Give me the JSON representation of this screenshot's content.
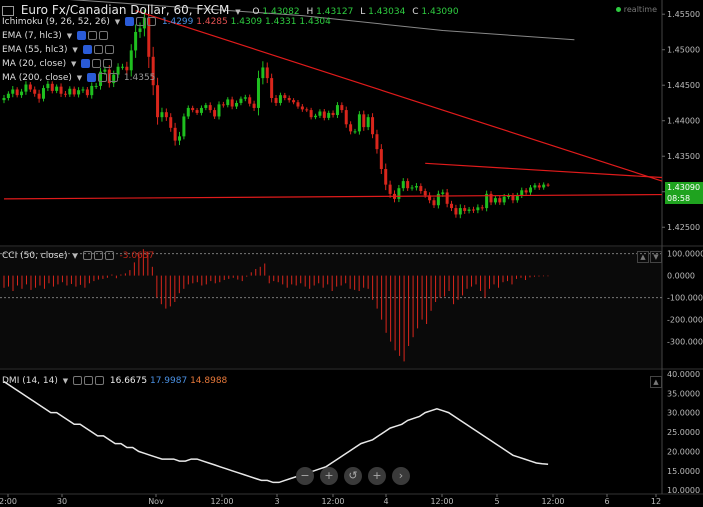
{
  "header": {
    "symbol": "Euro Fx/Canadian Dollar, 60, FXCM",
    "o_label": "O",
    "o": "1.43082",
    "h_label": "H",
    "h": "1.43127",
    "l_label": "L",
    "l": "1.43034",
    "c_label": "C",
    "c": "1.43090",
    "status": "realtime"
  },
  "indicators": [
    {
      "label": "Ichimoku (9, 26, 52, 26)",
      "values": [
        "1.4299",
        "1.4285",
        "1.4309",
        "1.4331",
        "1.4304"
      ]
    },
    {
      "label": "EMA (7, hlc3)",
      "values": []
    },
    {
      "label": "EMA (55, hlc3)",
      "values": []
    },
    {
      "label": "MA (20, close)",
      "values": []
    },
    {
      "label": "MA (200, close)",
      "values": [
        "1.4355"
      ]
    }
  ],
  "price_badge": {
    "price": "1.43090",
    "countdown": "08:58"
  },
  "cci": {
    "label": "CCI (50, close)",
    "value": "-3.0637"
  },
  "dmi": {
    "label": "DMI (14, 14)",
    "adx": "16.6675",
    "di_plus": "17.9987",
    "di_minus": "14.8988"
  },
  "colors": {
    "up": "#1fbf1f",
    "down": "#d9261c",
    "trend": "#e01b1b",
    "ma200": "#888888",
    "dmi": "#e8e8e8",
    "blue": "#4a90e2",
    "orange": "#e6783a",
    "green": "#2ecc40"
  },
  "icons": [
    "zoom-out-icon",
    "zoom-in-icon",
    "reset-icon",
    "add-icon",
    "pan-right-icon"
  ],
  "chart_data": [
    {
      "type": "candlestick",
      "title": "Euro Fx/Canadian Dollar, 60, FXCM",
      "ylim": [
        1.4225,
        1.457
      ],
      "yticks": [
        "1.45500",
        "1.45000",
        "1.44500",
        "1.44000",
        "1.43500",
        "1.43000",
        "1.42500"
      ],
      "x_ticks": [
        "2:00",
        "30",
        "Nov",
        "12:00",
        "3",
        "12:00",
        "4",
        "12:00",
        "5",
        "12:00",
        "6",
        "12"
      ],
      "close": [
        1.4432,
        1.4438,
        1.4444,
        1.4436,
        1.4441,
        1.4451,
        1.4444,
        1.4438,
        1.4431,
        1.4446,
        1.4452,
        1.4442,
        1.4448,
        1.4438,
        1.4437,
        1.4445,
        1.4437,
        1.4443,
        1.4444,
        1.4436,
        1.4449,
        1.4449,
        1.4469,
        1.4472,
        1.4453,
        1.4465,
        1.4476,
        1.4476,
        1.4471,
        1.4499,
        1.4525,
        1.453,
        1.4545,
        1.449,
        1.445,
        1.4405,
        1.4412,
        1.4405,
        1.439,
        1.4372,
        1.4378,
        1.4406,
        1.4418,
        1.4415,
        1.4411,
        1.4418,
        1.4422,
        1.4415,
        1.4406,
        1.4423,
        1.4422,
        1.443,
        1.442,
        1.4425,
        1.4431,
        1.4433,
        1.4424,
        1.4418,
        1.446,
        1.4475,
        1.446,
        1.4432,
        1.4425,
        1.4436,
        1.4432,
        1.4429,
        1.4426,
        1.442,
        1.4416,
        1.4415,
        1.4405,
        1.4407,
        1.4413,
        1.4404,
        1.4411,
        1.4408,
        1.4422,
        1.4415,
        1.4395,
        1.4385,
        1.4385,
        1.4409,
        1.4391,
        1.4405,
        1.4381,
        1.436,
        1.4332,
        1.431,
        1.4297,
        1.429,
        1.4305,
        1.4315,
        1.4305,
        1.4306,
        1.4308,
        1.4301,
        1.4295,
        1.4288,
        1.4281,
        1.4297,
        1.4299,
        1.4283,
        1.4277,
        1.4268,
        1.4277,
        1.4273,
        1.4275,
        1.4274,
        1.4278,
        1.4277,
        1.4297,
        1.4285,
        1.4291,
        1.4285,
        1.4293,
        1.4294,
        1.4288,
        1.4295,
        1.4302,
        1.4299,
        1.4306,
        1.4309,
        1.4306,
        1.431,
        1.4309
      ],
      "bar_range": [
        0.0012,
        0.001,
        0.0014,
        0.0009,
        0.0011,
        0.0013,
        0.001,
        0.0012,
        0.0016,
        0.0011,
        0.0012,
        0.001,
        0.0009,
        0.0013,
        0.0011,
        0.001,
        0.0009,
        0.0012,
        0.0011,
        0.001,
        0.0014,
        0.0012,
        0.0015,
        0.0013,
        0.0018,
        0.0016,
        0.0014,
        0.0012,
        0.002,
        0.0025,
        0.003,
        0.0024,
        0.0032,
        0.0045,
        0.004,
        0.003,
        0.0018,
        0.0015,
        0.0016,
        0.002,
        0.0018,
        0.0012,
        0.001,
        0.0009,
        0.0008,
        0.001,
        0.0009,
        0.0011,
        0.001,
        0.0012,
        0.001,
        0.0009,
        0.0011,
        0.001,
        0.0009,
        0.001,
        0.0011,
        0.0012,
        0.003,
        0.0025,
        0.002,
        0.0018,
        0.0012,
        0.001,
        0.0009,
        0.001,
        0.0008,
        0.0009,
        0.001,
        0.0008,
        0.0009,
        0.0008,
        0.0009,
        0.001,
        0.0009,
        0.001,
        0.0012,
        0.0011,
        0.0014,
        0.0012,
        0.001,
        0.0013,
        0.0015,
        0.0012,
        0.0016,
        0.0018,
        0.002,
        0.0022,
        0.0016,
        0.0014,
        0.0013,
        0.0012,
        0.0011,
        0.001,
        0.0012,
        0.0011,
        0.001,
        0.0012,
        0.0011,
        0.0013,
        0.0012,
        0.0014,
        0.0012,
        0.0013,
        0.0015,
        0.0012,
        0.001,
        0.0011,
        0.0012,
        0.001,
        0.0013,
        0.0011,
        0.0009,
        0.001,
        0.0011,
        0.001,
        0.0012,
        0.001,
        0.0011,
        0.0009,
        0.001,
        0.0009,
        0.001,
        0.0009,
        0.0006
      ],
      "ma200": [
        [
          0,
          1.4577
        ],
        [
          68,
          1.4548
        ],
        [
          100,
          1.4527
        ],
        [
          130,
          1.4514
        ]
      ],
      "trendlines": [
        [
          [
            30,
            1.4555
          ],
          [
            136,
            1.4315
          ]
        ],
        [
          [
            96,
            1.434
          ],
          [
            136,
            1.432
          ]
        ],
        [
          [
            0,
            1.429
          ],
          [
            166,
            1.4296
          ]
        ]
      ]
    },
    {
      "type": "bar",
      "title": "CCI (50, close)",
      "ylim": [
        -420,
        130
      ],
      "yticks": [
        "100.0000",
        "0.0000",
        "-100.0000",
        "-200.0000",
        "-300.0000"
      ],
      "levels": [
        100,
        -100
      ],
      "values": [
        -55,
        -50,
        -70,
        -45,
        -60,
        -40,
        -65,
        -55,
        -45,
        -60,
        -35,
        -50,
        -40,
        -30,
        -45,
        -38,
        -50,
        -42,
        -55,
        -35,
        -25,
        -18,
        -15,
        -10,
        5,
        -12,
        5,
        10,
        25,
        60,
        95,
        120,
        110,
        40,
        -100,
        -130,
        -150,
        -140,
        -120,
        -80,
        -60,
        -40,
        -35,
        -30,
        -45,
        -40,
        -25,
        -35,
        -30,
        -20,
        -15,
        -10,
        -18,
        -25,
        -5,
        15,
        30,
        40,
        55,
        -35,
        -25,
        -30,
        -40,
        -55,
        -40,
        -45,
        -35,
        -50,
        -60,
        -45,
        -35,
        -55,
        -40,
        -70,
        -50,
        -45,
        -35,
        -60,
        -65,
        -70,
        -55,
        -60,
        -110,
        -150,
        -200,
        -260,
        -300,
        -340,
        -365,
        -390,
        -320,
        -280,
        -240,
        -200,
        -220,
        -160,
        -120,
        -100,
        -95,
        -70,
        -130,
        -110,
        -90,
        -60,
        -50,
        -40,
        -70,
        -100,
        -60,
        -40,
        -55,
        -30,
        -25,
        -40,
        -15,
        -10,
        -20,
        -8,
        -5,
        -4,
        -3,
        -3
      ]
    },
    {
      "type": "line",
      "title": "DMI (14, 14)",
      "ylim": [
        9,
        41
      ],
      "yticks": [
        "40.0000",
        "35.0000",
        "30.0000",
        "25.0000",
        "20.0000",
        "15.0000",
        "10.0000"
      ],
      "values": [
        38,
        37,
        36,
        35,
        34,
        33,
        32,
        31,
        30,
        30,
        29,
        28,
        27,
        27,
        26,
        25,
        24,
        24,
        23,
        22,
        22,
        21,
        21,
        20,
        19.5,
        19,
        18.5,
        18,
        18,
        18,
        17.5,
        17.5,
        18,
        18,
        17.5,
        17,
        16.5,
        16,
        15.5,
        15,
        14.5,
        14,
        13.5,
        13,
        12.5,
        12.5,
        12,
        12,
        12.5,
        13,
        13.5,
        14,
        14.5,
        15,
        15.5,
        16,
        17,
        18,
        19,
        20,
        21,
        22,
        22.5,
        23,
        24,
        25,
        26,
        26.5,
        27,
        28,
        28.5,
        29,
        30,
        30.5,
        31,
        30.5,
        30,
        29,
        28,
        27,
        26,
        25,
        24,
        23,
        22,
        21,
        20,
        19,
        18.5,
        18,
        17.5,
        17,
        16.8,
        16.7
      ]
    }
  ]
}
